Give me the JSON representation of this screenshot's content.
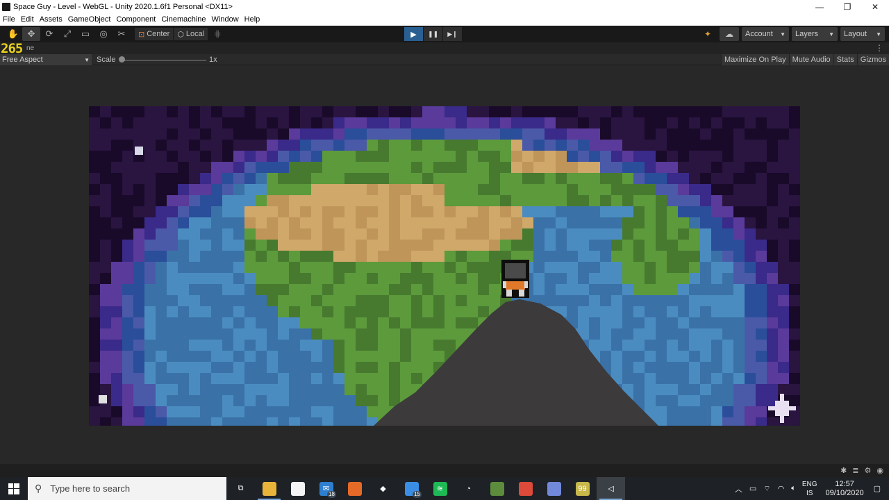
{
  "window": {
    "title": "Space Guy - Level - WebGL - Unity 2020.1.6f1 Personal <DX11>",
    "minimize": "—",
    "maximize": "❐",
    "close": "✕"
  },
  "menu": [
    "File",
    "Edit",
    "Assets",
    "GameObject",
    "Component",
    "Cinemachine",
    "Window",
    "Help"
  ],
  "toolbar": {
    "tools": [
      {
        "name": "hand-tool",
        "glyph": "✋"
      },
      {
        "name": "move-tool",
        "glyph": "✥"
      },
      {
        "name": "rotate-tool",
        "glyph": "⟳"
      },
      {
        "name": "scale-tool",
        "glyph": "⤢"
      },
      {
        "name": "rect-tool",
        "glyph": "▭"
      },
      {
        "name": "transform-tool",
        "glyph": "◎"
      },
      {
        "name": "custom-tool",
        "glyph": "✂"
      }
    ],
    "pivot_label": "Center",
    "rotation_label": "Local",
    "play_glyph": "▶",
    "pause_glyph": "❚❚",
    "step_glyph": "▶❙",
    "account_label": "Account",
    "layers_label": "Layers",
    "layout_label": "Layout"
  },
  "game_view": {
    "fps": "265",
    "tab_label": "ne",
    "aspect_label": "Free Aspect",
    "scale_label": "Scale",
    "scale_value": "1x",
    "scale_level": 0.0,
    "buttons": [
      "Maximize On Play",
      "Mute Audio",
      "Stats",
      "Gizmos"
    ]
  },
  "taskbar": {
    "search_placeholder": "Type here to search",
    "apps": [
      {
        "name": "task-view-icon",
        "glyph": "⧉",
        "color": "#1e2226",
        "badge": ""
      },
      {
        "name": "file-explorer-icon",
        "glyph": "",
        "color": "#e8b53a",
        "badge": ""
      },
      {
        "name": "store-icon",
        "glyph": "",
        "color": "#f4f4f4",
        "badge": ""
      },
      {
        "name": "mail-icon",
        "glyph": "✉",
        "color": "#2f7fd0",
        "badge": "18"
      },
      {
        "name": "firefox-icon",
        "glyph": "",
        "color": "#e66a27",
        "badge": ""
      },
      {
        "name": "dropbox-icon",
        "glyph": "◆",
        "color": "#1e2226",
        "badge": ""
      },
      {
        "name": "phone-icon",
        "glyph": "",
        "color": "#3a8ee6",
        "badge": "15"
      },
      {
        "name": "spotify-icon",
        "glyph": "≋",
        "color": "#1db954",
        "badge": ""
      },
      {
        "name": "speedometer-icon",
        "glyph": "◔",
        "color": "#1e2226",
        "badge": ""
      },
      {
        "name": "minecraft-icon",
        "glyph": "",
        "color": "#5d8c3c",
        "badge": ""
      },
      {
        "name": "chrome-icon",
        "glyph": "",
        "color": "#de4a3a",
        "badge": ""
      },
      {
        "name": "discord-icon",
        "glyph": "",
        "color": "#7289da",
        "badge": ""
      },
      {
        "name": "notes-icon",
        "glyph": "99",
        "color": "#c8b84a",
        "badge": ""
      },
      {
        "name": "unity-icon",
        "glyph": "◁",
        "color": "#3b4046",
        "badge": ""
      }
    ],
    "language": "ENG",
    "region": "IS",
    "time": "12:57",
    "date": "09/10/2020"
  },
  "colors": {
    "ocean": "#3a72a8",
    "ocean_light": "#4b8cc0",
    "land_green": "#5c9a3c",
    "land_dark": "#477a2f",
    "desert": "#cfa86a",
    "space": "#1a0a2a",
    "rim": "#3a2a8a",
    "rock": "#3c3a3b",
    "play_blue": "#2a5f92"
  }
}
